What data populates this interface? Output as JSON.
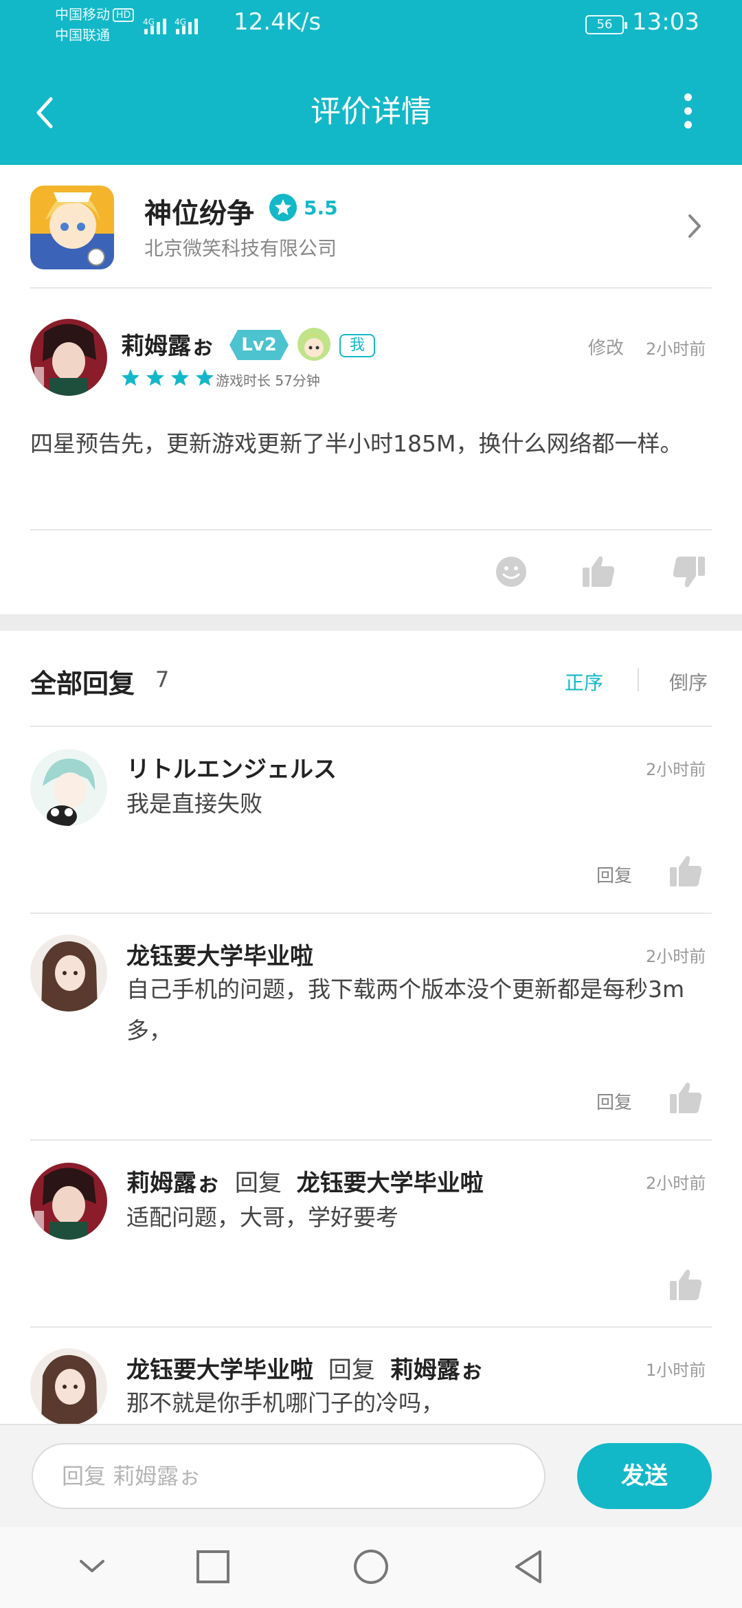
{
  "status_bar": {
    "carrier1": "中国移动",
    "hd": "HD",
    "carrier2": "中国联通",
    "net_type_1": "4G",
    "net_type_2": "4G",
    "speed": "12.4K/s",
    "battery": "56",
    "time": "13:03"
  },
  "nav": {
    "title": "评价详情"
  },
  "game": {
    "name": "神位纷争",
    "score": "5.5",
    "company": "北京微笑科技有限公司"
  },
  "review": {
    "author": "莉姆露ぉ",
    "level": "Lv2",
    "me_tag": "我",
    "edit": "修改",
    "time": "2小时前",
    "stars": 4,
    "playtime": "游戏时长 57分钟",
    "text": "四星预告先，更新游戏更新了半小时185M，换什么网络都一样。"
  },
  "replies_header": {
    "title": "全部回复",
    "count": "7",
    "sort_asc": "正序",
    "sort_desc": "倒序"
  },
  "replies": [
    {
      "name": "リトルエンジェルス",
      "text": "我是直接失败",
      "time": "2小时前",
      "action": "回复"
    },
    {
      "name": "龙钰要大学毕业啦",
      "text": "自己手机的问题，我下载两个版本没个更新都是每秒3m多，",
      "time": "2小时前",
      "action": "回复"
    },
    {
      "name": "莉姆露ぉ",
      "reply_word": "回复",
      "target": "龙钰要大学毕业啦",
      "text": "适配问题，大哥，学好要考",
      "time": "2小时前"
    },
    {
      "name": "龙钰要大学毕业啦",
      "reply_word": "回复",
      "target": "莉姆露ぉ",
      "text": "那不就是你手机哪门子的冷吗，",
      "time": "1小时前"
    }
  ],
  "input": {
    "placeholder": "回复 莉姆露ぉ",
    "send": "发送"
  },
  "colors": {
    "accent": "#13b8c8",
    "divider": "#e6e6e6"
  }
}
